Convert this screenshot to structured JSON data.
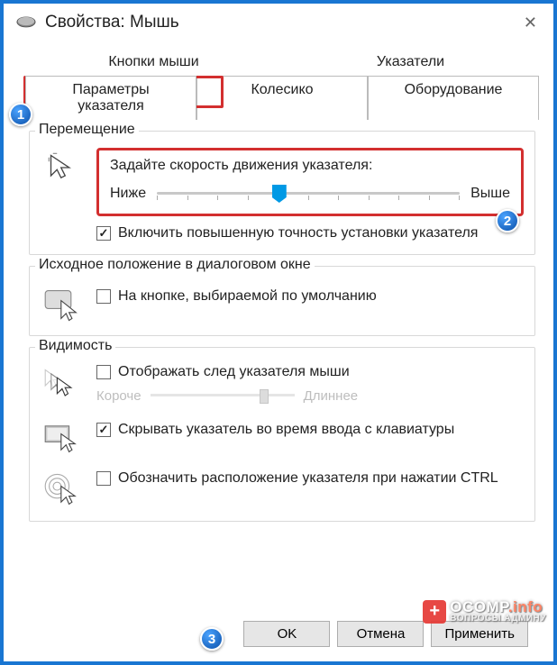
{
  "window": {
    "title": "Свойства: Мышь"
  },
  "tabs": {
    "row1": [
      "Кнопки мыши",
      "Указатели"
    ],
    "row2": [
      "Параметры указателя",
      "Колесико",
      "Оборудование"
    ],
    "activeIndex": 0
  },
  "groups": {
    "movement": {
      "title": "Перемещение",
      "speed_label": "Задайте скорость движения указателя:",
      "slower": "Ниже",
      "faster": "Выше",
      "precision_chk": "Включить повышенную точность установки указателя",
      "precision_checked": true
    },
    "snap": {
      "title": "Исходное положение в диалоговом окне",
      "default_btn_chk": "На кнопке, выбираемой по умолчанию",
      "default_btn_checked": false
    },
    "visibility": {
      "title": "Видимость",
      "trail_chk": "Отображать след указателя мыши",
      "trail_checked": false,
      "trail_shorter": "Короче",
      "trail_longer": "Длиннее",
      "hide_typing_chk": "Скрывать указатель во время ввода с клавиатуры",
      "hide_typing_checked": true,
      "ctrl_chk": "Обозначить расположение указателя при нажатии CTRL",
      "ctrl_checked": false
    }
  },
  "buttons": {
    "ok": "OK",
    "cancel": "Отмена",
    "apply": "Применить"
  },
  "callouts": {
    "c1": "1",
    "c2": "2",
    "c3": "3"
  },
  "watermark": {
    "main": "OCOMP",
    "tld": ".info",
    "sub": "ВОПРОСЫ АДМИНУ"
  }
}
